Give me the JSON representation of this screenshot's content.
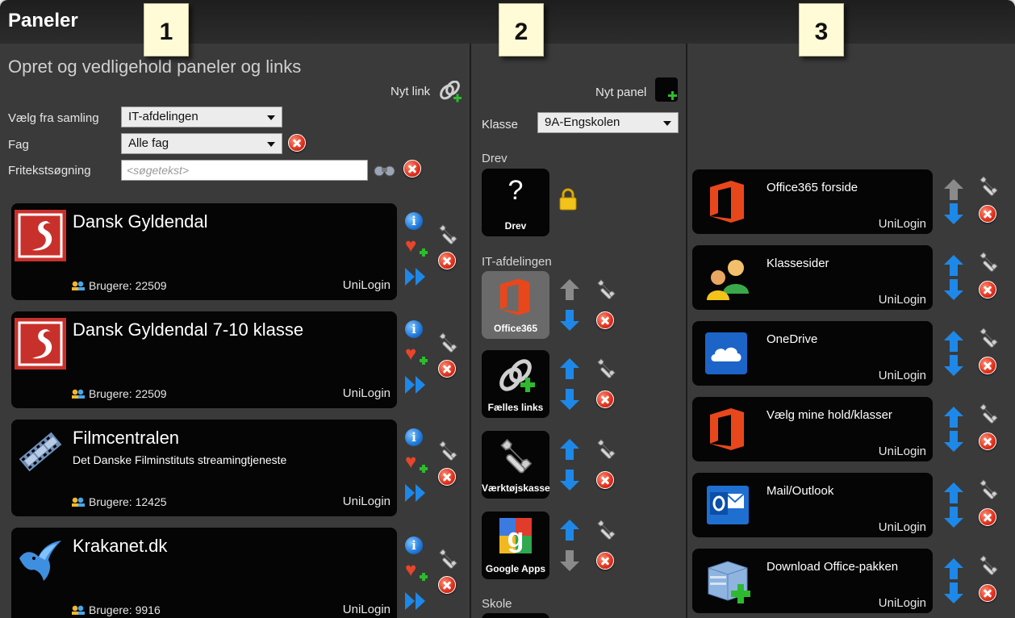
{
  "header": {
    "app_title": "Paneler",
    "subtitle": "Opret og vedligehold paneler og links",
    "callouts": [
      "1",
      "2",
      "3"
    ]
  },
  "col1": {
    "new_link_label": "Nyt link",
    "collection_label": "Vælg fra samling",
    "collection_value": "IT-afdelingen",
    "subject_label": "Fag",
    "subject_value": "Alle fag",
    "search_label": "Fritekstsøgning",
    "search_placeholder": "<søgetekst>",
    "cards": [
      {
        "title": "Dansk Gyldendal",
        "desc": "",
        "users": "Brugere: 22509",
        "login": "UniLogin",
        "icon": "gyldendal-logo"
      },
      {
        "title": "Dansk Gyldendal 7-10 klasse",
        "desc": "",
        "users": "Brugere: 22509",
        "login": "UniLogin",
        "icon": "gyldendal-logo"
      },
      {
        "title": "Filmcentralen",
        "desc": "Det Danske Filminstituts streamingtjeneste",
        "users": "Brugere: 12425",
        "login": "UniLogin",
        "icon": "filmstrip-logo"
      },
      {
        "title": "Krakanet.dk",
        "desc": "",
        "users": "Brugere: 9916",
        "login": "UniLogin",
        "icon": "bird-logo"
      }
    ]
  },
  "col2": {
    "new_panel_label": "Nyt panel",
    "class_label": "Klasse",
    "class_value": "9A-Engskolen",
    "drev_section": "Drev",
    "drev_tile_label": "Drev",
    "drev_icon_glyph": "?",
    "it_section": "IT-afdelingen",
    "tiles": [
      {
        "label": "Office365",
        "icon": "office-icon"
      },
      {
        "label": "Fælles links",
        "icon": "link-icon"
      },
      {
        "label": "Værktøjskasse",
        "icon": "wrench-icon"
      },
      {
        "label": "Google Apps",
        "icon": "google-apps-icon"
      }
    ],
    "school_section": "Skole"
  },
  "col3": {
    "cards": [
      {
        "title": "Office365 forside",
        "login": "UniLogin",
        "icon": "office-icon"
      },
      {
        "title": "Klassesider",
        "login": "UniLogin",
        "icon": "people-icon"
      },
      {
        "title": "OneDrive",
        "login": "UniLogin",
        "icon": "onedrive-icon"
      },
      {
        "title": "Vælg mine hold/klasser",
        "login": "UniLogin",
        "icon": "office-icon"
      },
      {
        "title": "Mail/Outlook",
        "login": "UniLogin",
        "icon": "outlook-icon"
      },
      {
        "title": "Download Office-pakken",
        "login": "UniLogin",
        "icon": "download-office-icon"
      }
    ]
  },
  "colors": {
    "accent_blue": "#1e88e8",
    "delete_red": "#e0301c",
    "office_orange": "#e8471c",
    "card_bg": "#050505",
    "panel_bg": "#3a3a3a"
  }
}
